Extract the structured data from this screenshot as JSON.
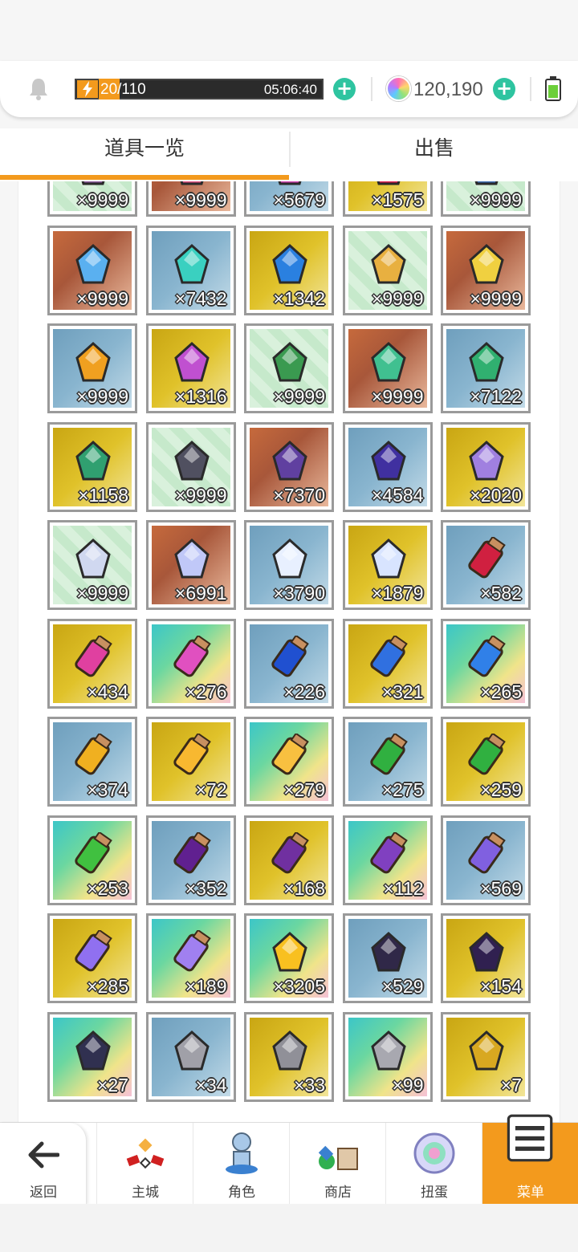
{
  "status": {
    "stamina_current": "20",
    "stamina_max": "/110",
    "timer": "05:06:40",
    "currency": "120,190"
  },
  "tabs": [
    {
      "label": "道具一览",
      "active": true
    },
    {
      "label": "出售",
      "active": false
    }
  ],
  "items": [
    {
      "qty": "×9999",
      "bg": "green",
      "icon": "dark-ore-icon",
      "color": "#8a5a9c"
    },
    {
      "qty": "×9999",
      "bg": "brown",
      "icon": "pink-crystal-icon",
      "color": "#e05080"
    },
    {
      "qty": "×5679",
      "bg": "blue",
      "icon": "magenta-crystal-icon",
      "color": "#d040b0"
    },
    {
      "qty": "×1575",
      "bg": "gold",
      "icon": "ruby-gem-icon",
      "color": "#e02050"
    },
    {
      "qty": "×9999",
      "bg": "green",
      "icon": "blue-ore-icon",
      "color": "#3a6ab0"
    },
    {
      "qty": "×9999",
      "bg": "brown",
      "icon": "blue-shard-icon",
      "color": "#5ab0f0"
    },
    {
      "qty": "×7432",
      "bg": "blue",
      "icon": "teal-crystal-icon",
      "color": "#3ad0c0"
    },
    {
      "qty": "×1342",
      "bg": "gold",
      "icon": "blue-orb-icon",
      "color": "#2a80e0"
    },
    {
      "qty": "×9999",
      "bg": "green",
      "icon": "gold-ore-icon",
      "color": "#e8b040"
    },
    {
      "qty": "×9999",
      "bg": "brown",
      "icon": "topaz-icon",
      "color": "#f0d040"
    },
    {
      "qty": "×9999",
      "bg": "blue",
      "icon": "amber-gem-icon",
      "color": "#f0a020"
    },
    {
      "qty": "×1316",
      "bg": "gold",
      "icon": "purple-emblem-icon",
      "color": "#c050d0"
    },
    {
      "qty": "×9999",
      "bg": "green",
      "icon": "green-ore-icon",
      "color": "#3a9a50"
    },
    {
      "qty": "×9999",
      "bg": "brown",
      "icon": "green-cluster-icon",
      "color": "#40c090"
    },
    {
      "qty": "×7122",
      "bg": "blue",
      "icon": "emerald-icon",
      "color": "#30b070"
    },
    {
      "qty": "×1158",
      "bg": "gold",
      "icon": "green-ring-icon",
      "color": "#30a070"
    },
    {
      "qty": "×9999",
      "bg": "green",
      "icon": "coal-icon",
      "color": "#505060"
    },
    {
      "qty": "×7370",
      "bg": "brown",
      "icon": "amethyst-icon",
      "color": "#6040a0"
    },
    {
      "qty": "×4584",
      "bg": "blue",
      "icon": "violet-orb-icon",
      "color": "#4030a0"
    },
    {
      "qty": "×2020",
      "bg": "gold",
      "icon": "winged-gem-icon",
      "color": "#a080e0"
    },
    {
      "qty": "×9999",
      "bg": "green",
      "icon": "quartz-ore-icon",
      "color": "#d0d8f0"
    },
    {
      "qty": "×6991",
      "bg": "brown",
      "icon": "white-crystal-icon",
      "color": "#c0c8f8"
    },
    {
      "qty": "×3790",
      "bg": "blue",
      "icon": "diamond-icon",
      "color": "#e8f0ff"
    },
    {
      "qty": "×1879",
      "bg": "gold",
      "icon": "winged-crystal-icon",
      "color": "#d8e4ff"
    },
    {
      "qty": "×582",
      "bg": "blue",
      "icon": "red-scroll-icon",
      "color": "#d02040"
    },
    {
      "qty": "×434",
      "bg": "gold",
      "icon": "pink-scroll-icon",
      "color": "#e040a0"
    },
    {
      "qty": "×276",
      "bg": "rainbow",
      "icon": "pink-scroll-icon",
      "color": "#e050c0"
    },
    {
      "qty": "×226",
      "bg": "blue",
      "icon": "blue-scroll-icon",
      "color": "#2050d0"
    },
    {
      "qty": "×321",
      "bg": "gold",
      "icon": "blue-scroll-icon",
      "color": "#3070e0"
    },
    {
      "qty": "×265",
      "bg": "rainbow",
      "icon": "blue-scroll-icon",
      "color": "#3080e8"
    },
    {
      "qty": "×374",
      "bg": "blue",
      "icon": "yellow-scroll-icon",
      "color": "#f0b020"
    },
    {
      "qty": "×72",
      "bg": "gold",
      "icon": "yellow-scroll-icon",
      "color": "#f8b830"
    },
    {
      "qty": "×279",
      "bg": "rainbow",
      "icon": "yellow-scroll-icon",
      "color": "#f8c040"
    },
    {
      "qty": "×275",
      "bg": "blue",
      "icon": "green-scroll-icon",
      "color": "#30b040"
    },
    {
      "qty": "×259",
      "bg": "gold",
      "icon": "green-scroll-icon",
      "color": "#30b040"
    },
    {
      "qty": "×253",
      "bg": "rainbow",
      "icon": "green-scroll-icon",
      "color": "#40c040"
    },
    {
      "qty": "×352",
      "bg": "blue",
      "icon": "purple-scroll-icon",
      "color": "#602090"
    },
    {
      "qty": "×168",
      "bg": "gold",
      "icon": "purple-scroll-icon",
      "color": "#7030a0"
    },
    {
      "qty": "×112",
      "bg": "rainbow",
      "icon": "purple-scroll-icon",
      "color": "#8040c0"
    },
    {
      "qty": "×569",
      "bg": "blue",
      "icon": "lavender-scroll-icon",
      "color": "#8060e0"
    },
    {
      "qty": "×285",
      "bg": "gold",
      "icon": "lavender-scroll-icon",
      "color": "#9070f0"
    },
    {
      "qty": "×189",
      "bg": "rainbow",
      "icon": "lavender-scroll-icon",
      "color": "#a080f0"
    },
    {
      "qty": "×3205",
      "bg": "rainbow",
      "icon": "star-sparkle-icon",
      "color": "#f8c020"
    },
    {
      "qty": "×529",
      "bg": "blue",
      "icon": "rune-tile-icon",
      "color": "#302848"
    },
    {
      "qty": "×154",
      "bg": "gold",
      "icon": "rune-card-icon",
      "color": "#302050"
    },
    {
      "qty": "×27",
      "bg": "rainbow",
      "icon": "rune-emblem-icon",
      "color": "#303050"
    },
    {
      "qty": "×34",
      "bg": "blue",
      "icon": "silver-shard-icon",
      "color": "#a0a0a8"
    },
    {
      "qty": "×33",
      "bg": "gold",
      "icon": "iron-shard-icon",
      "color": "#909098"
    },
    {
      "qty": "×99",
      "bg": "rainbow",
      "icon": "iron-block-icon",
      "color": "#a8a8b0"
    },
    {
      "qty": "×7",
      "bg": "gold",
      "icon": "gold-ingot-icon",
      "color": "#d8a820"
    }
  ],
  "nav": [
    {
      "label": "返回",
      "icon": "back-arrow-icon"
    },
    {
      "label": "主城",
      "icon": "castle-icon"
    },
    {
      "label": "角色",
      "icon": "character-icon"
    },
    {
      "label": "商店",
      "icon": "shop-icon"
    },
    {
      "label": "扭蛋",
      "icon": "gacha-icon"
    },
    {
      "label": "菜单",
      "icon": "menu-icon",
      "active": true
    }
  ],
  "colors": {
    "accent": "#f39a1d",
    "plus": "#2ec4a0"
  }
}
